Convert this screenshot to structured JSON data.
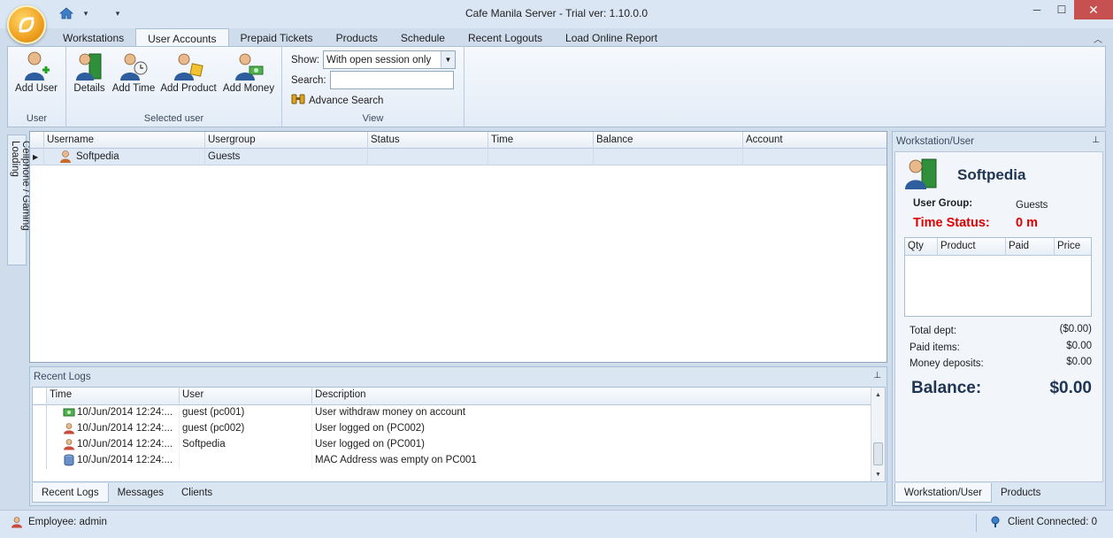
{
  "window": {
    "title": "Cafe Manila Server - Trial ver: 1.10.0.0",
    "minimize": "─",
    "maximize": "☐",
    "close": "✕"
  },
  "tabs": [
    "Workstations",
    "User Accounts",
    "Prepaid Tickets",
    "Products",
    "Schedule",
    "Recent Logouts",
    "Load Online Report"
  ],
  "active_tab": "User Accounts",
  "ribbon": {
    "user_group": {
      "label": "User",
      "add_user": "Add User"
    },
    "selected_user_group": {
      "label": "Selected user",
      "details": "Details",
      "add_time": "Add Time",
      "add_product": "Add Product",
      "add_money": "Add Money"
    },
    "view_group": {
      "label": "View",
      "show_label": "Show:",
      "show_value": "With open session only",
      "search_label": "Search:",
      "search_value": "",
      "advance_search": "Advance Search"
    }
  },
  "side_tab": "Cellphone / Gaming Loading",
  "users_grid": {
    "columns": [
      "Username",
      "Usergroup",
      "Status",
      "Time",
      "Balance",
      "Account"
    ],
    "rows": [
      {
        "username": "Softpedia",
        "usergroup": "Guests",
        "status": "",
        "time": "",
        "balance": "",
        "account": ""
      }
    ]
  },
  "recent_logs": {
    "title": "Recent Logs",
    "columns": [
      "Time",
      "User",
      "Description"
    ],
    "rows": [
      {
        "time": "10/Jun/2014 12:24:...",
        "user": "guest (pc001)",
        "description": "User withdraw money on account"
      },
      {
        "time": "10/Jun/2014 12:24:...",
        "user": "guest (pc002)",
        "description": "User logged on (PC002)"
      },
      {
        "time": "10/Jun/2014 12:24:...",
        "user": "Softpedia",
        "description": "User logged on (PC001)"
      },
      {
        "time": "10/Jun/2014 12:24:...",
        "user": "",
        "description": "MAC Address was empty on PC001"
      }
    ],
    "tabs": [
      "Recent Logs",
      "Messages",
      "Clients"
    ]
  },
  "workstation_user": {
    "title": "Workstation/User",
    "name": "Softpedia",
    "user_group_label": "User Group:",
    "user_group_value": "Guests",
    "time_status_label": "Time Status:",
    "time_status_value": "0 m",
    "columns": [
      "Qty",
      "Product",
      "Paid",
      "Price"
    ],
    "total_dept_label": "Total dept:",
    "total_dept_value": "($0.00)",
    "paid_items_label": "Paid items:",
    "paid_items_value": "$0.00",
    "money_deposits_label": "Money deposits:",
    "money_deposits_value": "$0.00",
    "balance_label": "Balance:",
    "balance_value": "$0.00",
    "tabs": [
      "Workstation/User",
      "Products"
    ]
  },
  "status": {
    "employee": "Employee: admin",
    "client_connected": "Client Connected: 0"
  }
}
